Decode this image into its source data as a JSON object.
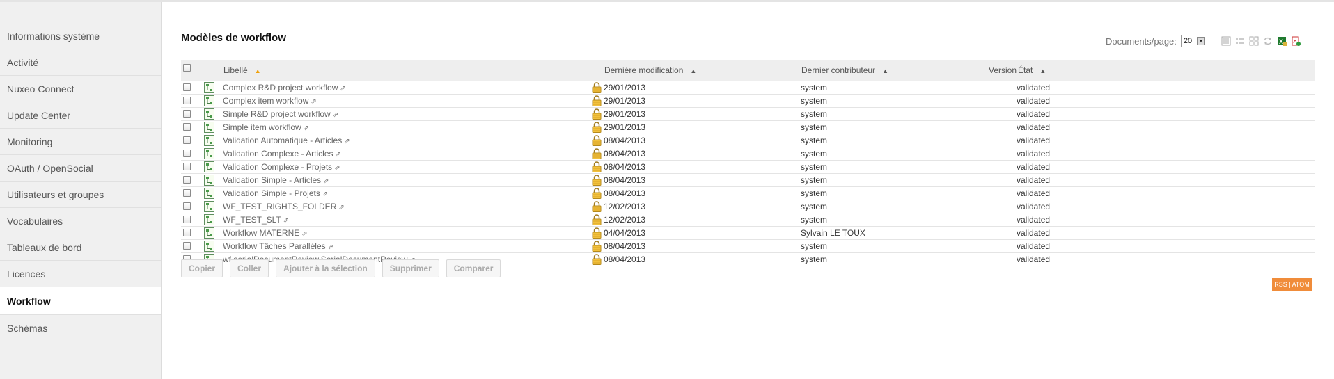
{
  "sidebar": {
    "items": [
      {
        "label": "Informations système",
        "active": false
      },
      {
        "label": "Activité",
        "active": false
      },
      {
        "label": "Nuxeo Connect",
        "active": false
      },
      {
        "label": "Update Center",
        "active": false
      },
      {
        "label": "Monitoring",
        "active": false
      },
      {
        "label": "OAuth / OpenSocial",
        "active": false
      },
      {
        "label": "Utilisateurs et groupes",
        "active": false
      },
      {
        "label": "Vocabulaires",
        "active": false
      },
      {
        "label": "Tableaux de bord",
        "active": false
      },
      {
        "label": "Licences",
        "active": false
      },
      {
        "label": "Workflow",
        "active": true
      },
      {
        "label": "Schémas",
        "active": false
      }
    ]
  },
  "page": {
    "title": "Modèles de workflow",
    "docs_per_page_label": "Documents/page:",
    "docs_per_page_value": "20"
  },
  "table": {
    "headers": {
      "title": "Libellé",
      "modified": "Dernière modification",
      "contributor": "Dernier contributeur",
      "version": "Version",
      "state": "État"
    },
    "rows": [
      {
        "title": "Complex R&D project workflow",
        "modified": "29/01/2013",
        "contributor": "system",
        "version": "",
        "state": "validated"
      },
      {
        "title": "Complex item workflow",
        "modified": "29/01/2013",
        "contributor": "system",
        "version": "",
        "state": "validated"
      },
      {
        "title": "Simple R&D project workflow",
        "modified": "29/01/2013",
        "contributor": "system",
        "version": "",
        "state": "validated"
      },
      {
        "title": "Simple item workflow",
        "modified": "29/01/2013",
        "contributor": "system",
        "version": "",
        "state": "validated"
      },
      {
        "title": "Validation Automatique - Articles",
        "modified": "08/04/2013",
        "contributor": "system",
        "version": "",
        "state": "validated"
      },
      {
        "title": "Validation Complexe - Articles",
        "modified": "08/04/2013",
        "contributor": "system",
        "version": "",
        "state": "validated"
      },
      {
        "title": "Validation Complexe - Projets",
        "modified": "08/04/2013",
        "contributor": "system",
        "version": "",
        "state": "validated"
      },
      {
        "title": "Validation Simple - Articles",
        "modified": "08/04/2013",
        "contributor": "system",
        "version": "",
        "state": "validated"
      },
      {
        "title": "Validation Simple - Projets",
        "modified": "08/04/2013",
        "contributor": "system",
        "version": "",
        "state": "validated"
      },
      {
        "title": "WF_TEST_RIGHTS_FOLDER",
        "modified": "12/02/2013",
        "contributor": "system",
        "version": "",
        "state": "validated"
      },
      {
        "title": "WF_TEST_SLT",
        "modified": "12/02/2013",
        "contributor": "system",
        "version": "",
        "state": "validated"
      },
      {
        "title": "Workflow MATERNE",
        "modified": "04/04/2013",
        "contributor": "Sylvain LE TOUX",
        "version": "",
        "state": "validated"
      },
      {
        "title": "Workflow Tâches Parallèles",
        "modified": "08/04/2013",
        "contributor": "system",
        "version": "",
        "state": "validated"
      },
      {
        "title": "wf.serialDocumentReview.SerialDocumentReview",
        "modified": "08/04/2013",
        "contributor": "system",
        "version": "",
        "state": "validated"
      }
    ]
  },
  "actions": {
    "copy": "Copier",
    "paste": "Coller",
    "add_selection": "Ajouter à la sélection",
    "delete": "Supprimer",
    "compare": "Comparer"
  },
  "feed": {
    "label": "RSS | ATOM"
  },
  "icons": {
    "view_list": "list-view-icon",
    "view_compact": "compact-list-view-icon",
    "view_thumbnails": "thumbnail-view-icon",
    "refresh": "refresh-icon",
    "export_excel": "excel-export-icon",
    "export_pdf": "pdf-export-icon"
  },
  "colors": {
    "accent_orange": "#f08c3a",
    "sort_arrow_active": "#f0a10a"
  }
}
